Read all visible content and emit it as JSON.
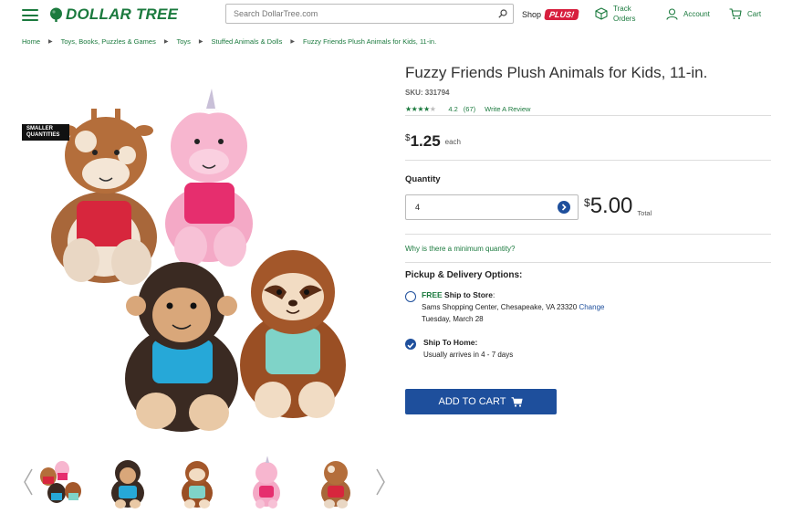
{
  "header": {
    "logo": "DOLLAR TREE",
    "search_placeholder": "Search DollarTree.com",
    "shop_label": "Shop",
    "plus_label": "PLUS!",
    "track_orders": "Track Orders",
    "track_line1": "Track",
    "track_line2": "Orders",
    "account": "Account",
    "cart": "Cart"
  },
  "breadcrumb": [
    "Home",
    "Toys, Books, Puzzles & Games",
    "Toys",
    "Stuffed Animals & Dolls",
    "Fuzzy Friends Plush Animals for Kids, 11-in."
  ],
  "gallery": {
    "badge_line1": "SMALLER",
    "badge_line2": "QUANTITIES",
    "thumbnails": [
      "group",
      "monkey",
      "sloth",
      "unicorn",
      "giraffe"
    ]
  },
  "product": {
    "title": "Fuzzy Friends Plush Animals for Kids, 11-in.",
    "sku": "SKU: 331794",
    "rating_value": 4.2,
    "rating": "4.2",
    "review_count": "(67)",
    "write_review": "Write A Review",
    "currency": "$",
    "price": "1.25",
    "price_unit": "each",
    "quantity_label": "Quantity",
    "quantity_value": "4",
    "total_amount": "5.00",
    "total_label": "Total",
    "min_qty_link": "Why is there a minimum quantity?"
  },
  "delivery": {
    "heading": "Pickup & Delivery Options:",
    "ship_store_free": "FREE",
    "ship_store_label": "Ship to Store",
    "ship_store_colon": ":",
    "store_address": "Sams Shopping Center, Chesapeake, VA 23320",
    "change_link": "Change",
    "store_date": "Tuesday, March 28",
    "ship_home_label": "Ship To Home:",
    "ship_home_detail": "Usually arrives in 4 - 7 days",
    "selected": "ship_home"
  },
  "actions": {
    "add_to_cart": "ADD TO CART"
  },
  "colors": {
    "brand_green": "#1b7a3e",
    "cta_blue": "#1e4f9c",
    "plus_red": "#d71f3e"
  }
}
